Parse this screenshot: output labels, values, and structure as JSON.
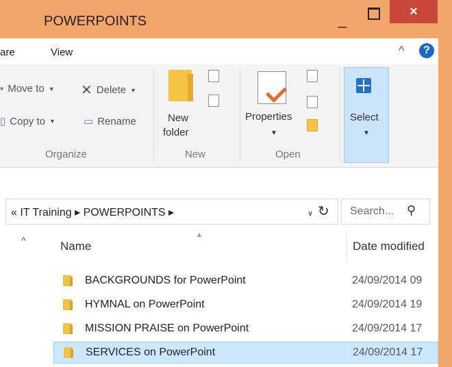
{
  "window": {
    "title": "POWERPOINTS",
    "minimize": "_",
    "close": "×"
  },
  "ribbon_tabs": {
    "share_partial": "are",
    "view": "View"
  },
  "ribbon": {
    "organize": {
      "move_to": "Move to",
      "copy_to": "Copy to",
      "delete": "Delete",
      "rename": "Rename",
      "label": "Organize"
    },
    "new": {
      "new_folder_line1": "New",
      "new_folder_line2": "folder",
      "label": "New"
    },
    "open": {
      "properties": "Properties",
      "label": "Open"
    },
    "select": {
      "label": "Select"
    }
  },
  "address": {
    "path": "« IT Training ▸ POWERPOINTS ▸",
    "search_placeholder": "Search...",
    "search_value": "Search..."
  },
  "columns": {
    "name": "Name",
    "date_modified": "Date modified"
  },
  "rows": [
    {
      "name": "BACKGROUNDS for PowerPoint",
      "date": "24/09/2014 09"
    },
    {
      "name": "HYMNAL on PowerPoint",
      "date": "24/09/2014 19"
    },
    {
      "name": "MISSION PRAISE on PowerPoint",
      "date": "24/09/2014 17"
    },
    {
      "name": "SERVICES on PowerPoint",
      "date": "24/09/2014 17"
    }
  ],
  "colors": {
    "title_bar": "#f3a669",
    "close_button": "#c9463a",
    "selection": "#cce8ff",
    "accent": "#1f74c7"
  }
}
